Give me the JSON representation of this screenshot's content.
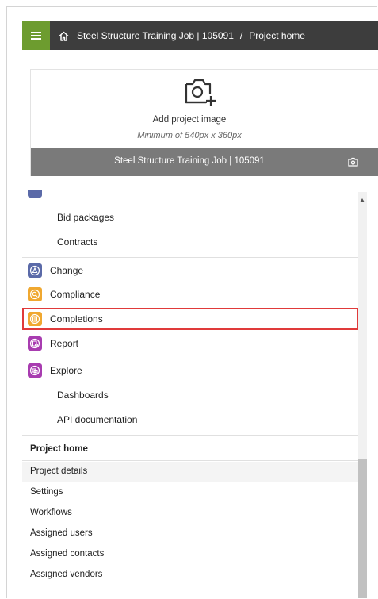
{
  "header": {
    "menu_icon": "hamburger-icon",
    "home_icon": "home-icon",
    "breadcrumb_job": "Steel Structure Training Job | 105091",
    "breadcrumb_sep": "/",
    "breadcrumb_page": "Project home",
    "bar_color": "#3d3d3d",
    "menu_color": "#6d9c2f"
  },
  "project_card": {
    "camera_icon": "add-camera-icon",
    "add_image": "Add project image",
    "min_size": "Minimum of 540px x 360px",
    "project_name": "Steel Structure Training Job | 105091",
    "small_camera_icon": "camera-icon"
  },
  "nav": {
    "sub_items_top": [
      "Bid packages",
      "Contracts"
    ],
    "modules": [
      {
        "label": "Change",
        "icon": "change-icon",
        "color": "#5b6aa8"
      },
      {
        "label": "Compliance",
        "icon": "compliance-icon",
        "color": "#f0a830"
      },
      {
        "label": "Completions",
        "icon": "completions-icon",
        "color": "#f0a830"
      },
      {
        "label": "Report",
        "icon": "report-icon",
        "color": "#a83cb0"
      },
      {
        "label": "Explore",
        "icon": "explore-icon",
        "color": "#a83cb0"
      }
    ],
    "explore_sub": [
      "Dashboards",
      "API documentation"
    ]
  },
  "project_home": {
    "heading": "Project home",
    "items": [
      "Project details",
      "Settings",
      "Workflows",
      "Assigned users",
      "Assigned contacts",
      "Assigned vendors"
    ]
  },
  "highlight_color": "#e03a3a"
}
